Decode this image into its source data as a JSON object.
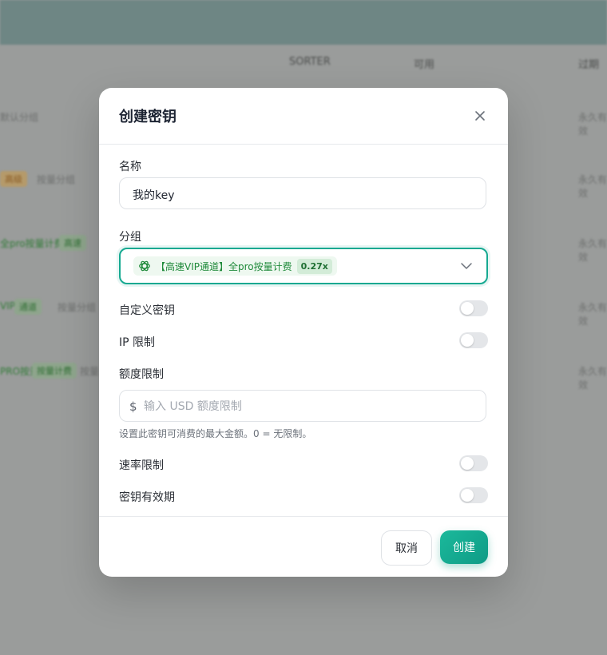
{
  "background": {
    "columns": [
      "SORTER",
      "可用",
      "过期"
    ],
    "rows": [
      {
        "left": "默认分组",
        "right": "永久有效"
      },
      {
        "tag": "高级",
        "left": "按量分组",
        "right": "永久有效"
      },
      {
        "green": "全pro按量计费",
        "tag": "高速",
        "right": "永久有效"
      },
      {
        "green": "VIP",
        "tag": "通道",
        "left": "按量分组",
        "right": "永久有效"
      },
      {
        "green": "PRO按量",
        "tag": "按量计费",
        "left": "按量",
        "right": "永久有效"
      }
    ]
  },
  "modal": {
    "title": "创建密钥",
    "name_label": "名称",
    "name_value": "我的key",
    "group_label": "分组",
    "group": {
      "icon": "openai-icon",
      "text": "【高速VIP通道】全pro按量计费",
      "multiplier": "0.27x"
    },
    "toggles": {
      "custom_key": {
        "label": "自定义密钥",
        "on": false
      },
      "ip_limit": {
        "label": "IP 限制",
        "on": false
      },
      "rate_limit": {
        "label": "速率限制",
        "on": false
      },
      "expiry": {
        "label": "密钥有效期",
        "on": false
      }
    },
    "quota_label": "额度限制",
    "quota_currency": "$",
    "quota_placeholder": "输入 USD 额度限制",
    "quota_hint": "设置此密钥可消费的最大金额。0 = 无限制。",
    "cancel_label": "取消",
    "create_label": "创建"
  },
  "colors": {
    "accent": "#16a991",
    "overlay": "#9a9c9b"
  }
}
